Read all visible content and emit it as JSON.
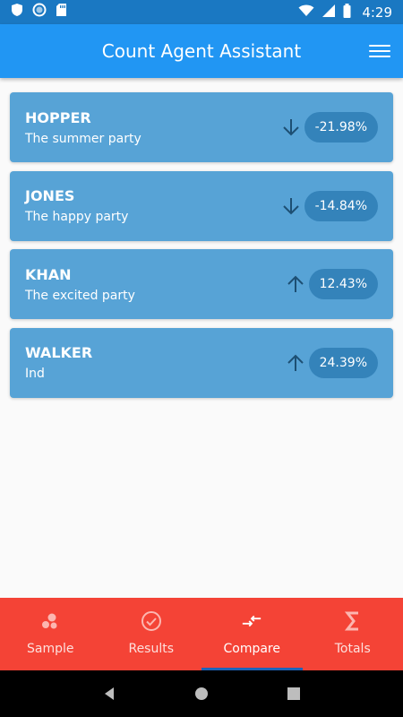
{
  "status_bar": {
    "time": "4:29"
  },
  "app_bar": {
    "title": "Count Agent Assistant"
  },
  "candidates": [
    {
      "name": "HOPPER",
      "party": "The summer party",
      "trend": "down",
      "change": "-21.98%"
    },
    {
      "name": "JONES",
      "party": "The happy party",
      "trend": "down",
      "change": "-14.84%"
    },
    {
      "name": "KHAN",
      "party": "The excited party",
      "trend": "up",
      "change": "12.43%"
    },
    {
      "name": "WALKER",
      "party": "Ind",
      "trend": "up",
      "change": "24.39%"
    }
  ],
  "bottom_nav": {
    "items": [
      {
        "label": "Sample",
        "icon": "bubbles-icon"
      },
      {
        "label": "Results",
        "icon": "check-circle-icon"
      },
      {
        "label": "Compare",
        "icon": "compare-arrows-icon",
        "active": true
      },
      {
        "label": "Totals",
        "icon": "sigma-icon"
      }
    ]
  },
  "colors": {
    "status_bar": "#1a78c2",
    "app_bar": "#2196f3",
    "card": "#57a3d6",
    "badge": "#3483ba",
    "bottom_nav": "#f44336"
  }
}
